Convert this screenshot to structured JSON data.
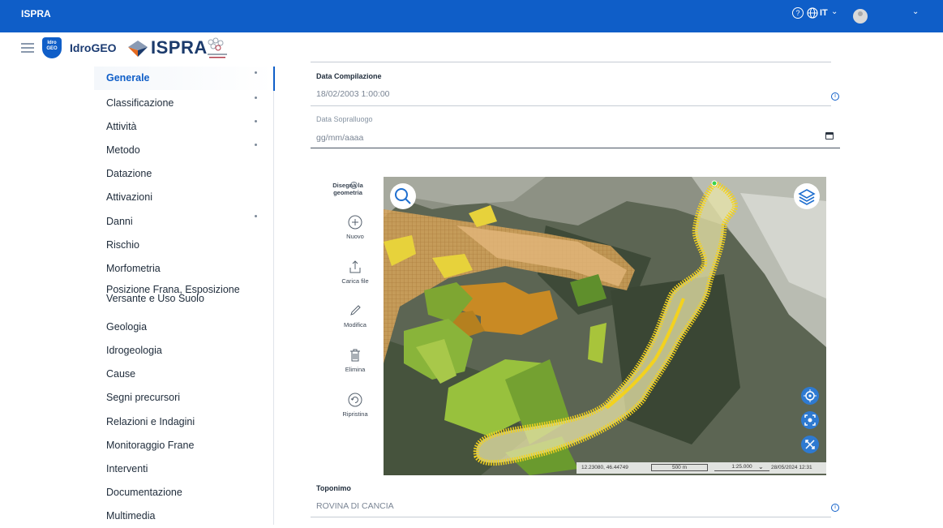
{
  "topbar": {
    "brand": "ISPRA",
    "help_icon": "question-circle-icon",
    "globe_icon": "globe-icon",
    "language": "IT",
    "user_icon": "avatar-icon",
    "colors": {
      "primary": "#0f5ec8"
    }
  },
  "header": {
    "app_name": "IdroGEO",
    "org_name": "ISPRA",
    "idro_badge": "Idro GEO"
  },
  "sidebar": {
    "items": [
      {
        "label": "Generale",
        "active": true,
        "marker": true
      },
      {
        "label": "Classificazione",
        "marker": true
      },
      {
        "label": "Attività",
        "marker": true
      },
      {
        "label": "Metodo",
        "marker": true
      },
      {
        "label": "Datazione"
      },
      {
        "label": "Attivazioni"
      },
      {
        "label": "Danni",
        "marker": true
      },
      {
        "label": "Rischio"
      },
      {
        "label": "Morfometria"
      },
      {
        "label": "Posizione Frana, Esposizione Versante e Uso Suolo"
      },
      {
        "label": "Geologia"
      },
      {
        "label": "Idrogeologia"
      },
      {
        "label": "Cause"
      },
      {
        "label": "Segni precursori"
      },
      {
        "label": "Relazioni e Indagini"
      },
      {
        "label": "Monitoraggio Frane"
      },
      {
        "label": "Interventi"
      },
      {
        "label": "Documentazione"
      },
      {
        "label": "Multimedia"
      }
    ]
  },
  "form": {
    "data_compilazione": {
      "label": "Data Compilazione",
      "value": "18/02/2003 1:00:00",
      "info_icon": "info-icon"
    },
    "data_sopralluogo": {
      "label": "Data Sopralluogo",
      "placeholder": "gg/mm/aaaa",
      "calendar_icon": "calendar-icon"
    },
    "toponimo": {
      "label": "Toponimo",
      "value": "ROVINA DI CANCIA",
      "info_icon": "info-icon"
    }
  },
  "map_tools": {
    "title": "Disegna la geometria",
    "tools": [
      {
        "label": "Nuovo",
        "icon": "plus-circle-icon"
      },
      {
        "label": "Carica file",
        "icon": "upload-icon"
      },
      {
        "label": "Modifica",
        "icon": "pencil-icon"
      },
      {
        "label": "Elimina",
        "icon": "trash-icon"
      },
      {
        "label": "Ripristina",
        "icon": "refresh-icon"
      }
    ]
  },
  "map": {
    "coordinates": "12.23080, 46.44749",
    "scale_distance": "500 m",
    "scale_ratio": "1:25.000",
    "timestamp": "28/05/2024 12:31",
    "buttons": [
      "search-icon",
      "layers-icon",
      "locate-icon",
      "center-icon",
      "fullscreen-icon"
    ]
  }
}
